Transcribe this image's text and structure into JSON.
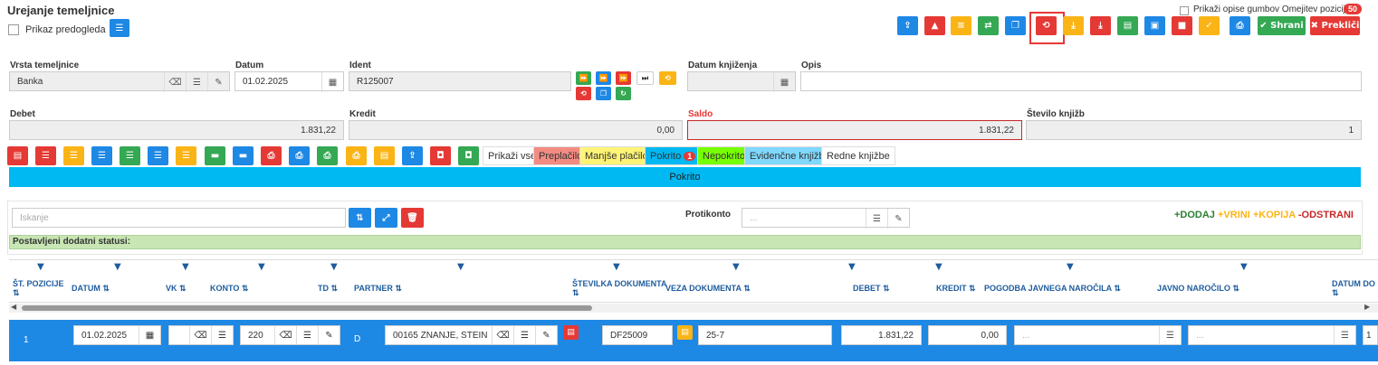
{
  "page": {
    "title": "Urejanje temeljnice",
    "preview_label": "Prikaz predogleda",
    "show_desc_label": "Prikaži opise gumbov",
    "limit_label": "Omejitev pozicij:",
    "limit_value": "50",
    "save_label": "Shrani",
    "cancel_label": "Prekliči"
  },
  "form": {
    "vrsta_label": "Vrsta temeljnice",
    "vrsta_value": "Banka",
    "datum_label": "Datum",
    "datum_value": "01.02.2025",
    "ident_label": "Ident",
    "ident_value": "R125007",
    "datum_knjizenja_label": "Datum knjiženja",
    "opis_label": "Opis",
    "debet_label": "Debet",
    "debet_value": "1.831,22",
    "kredit_label": "Kredit",
    "kredit_value": "0,00",
    "saldo_label": "Saldo",
    "saldo_value": "1.831,22",
    "stevilo_label": "Število knjižb",
    "stevilo_value": "1"
  },
  "filters": {
    "show_all": "Prikaži vse",
    "preplacilo": "Preplačilo",
    "manjse": "Manjše plačilo",
    "pokrito": "Pokrito",
    "pokrito_count": "1",
    "nepokrito": "Nepokrito",
    "evidencne": "Evidenčne knjižbe",
    "redne": "Redne knjižbe",
    "active_band": "Pokrito"
  },
  "search": {
    "placeholder": "Iskanje",
    "protikonto_label": "Protikonto",
    "protikonto_placeholder": "...",
    "dodaj": "+DODAJ",
    "vrini": "+VRINI",
    "kopija": "+KOPIJA",
    "odstrani": "-ODSTRANI",
    "statuses": "Postavljeni dodatni statusi:"
  },
  "table": {
    "headers": [
      "ŠT. POZICIJE",
      "DATUM",
      "VK",
      "KONTO",
      "TD",
      "PARTNER",
      "ŠTEVILKA DOKUMENTA",
      "VEZA DOKUMENTA",
      "DEBET",
      "KREDIT",
      "POGODBA JAVNEGA NAROČILA",
      "JAVNO NAROČILO",
      "DATUM DO"
    ],
    "row": {
      "pozicija": "1",
      "datum": "01.02.2025",
      "konto": "220",
      "td": "D",
      "partner": "00165 ZNANJE, STEIN",
      "st_dok": "DF25009",
      "veza": "25-7",
      "debet": "1.831,22",
      "kredit": "0,00",
      "pogodba": "...",
      "javno": "...",
      "datum_do": "1"
    }
  },
  "colors": {
    "blue": "#1e88e5",
    "red": "#e53935",
    "yellow": "#fbb416",
    "green": "#34a853",
    "cyan": "#00b8f2",
    "row_blue": "#1e88e5"
  }
}
